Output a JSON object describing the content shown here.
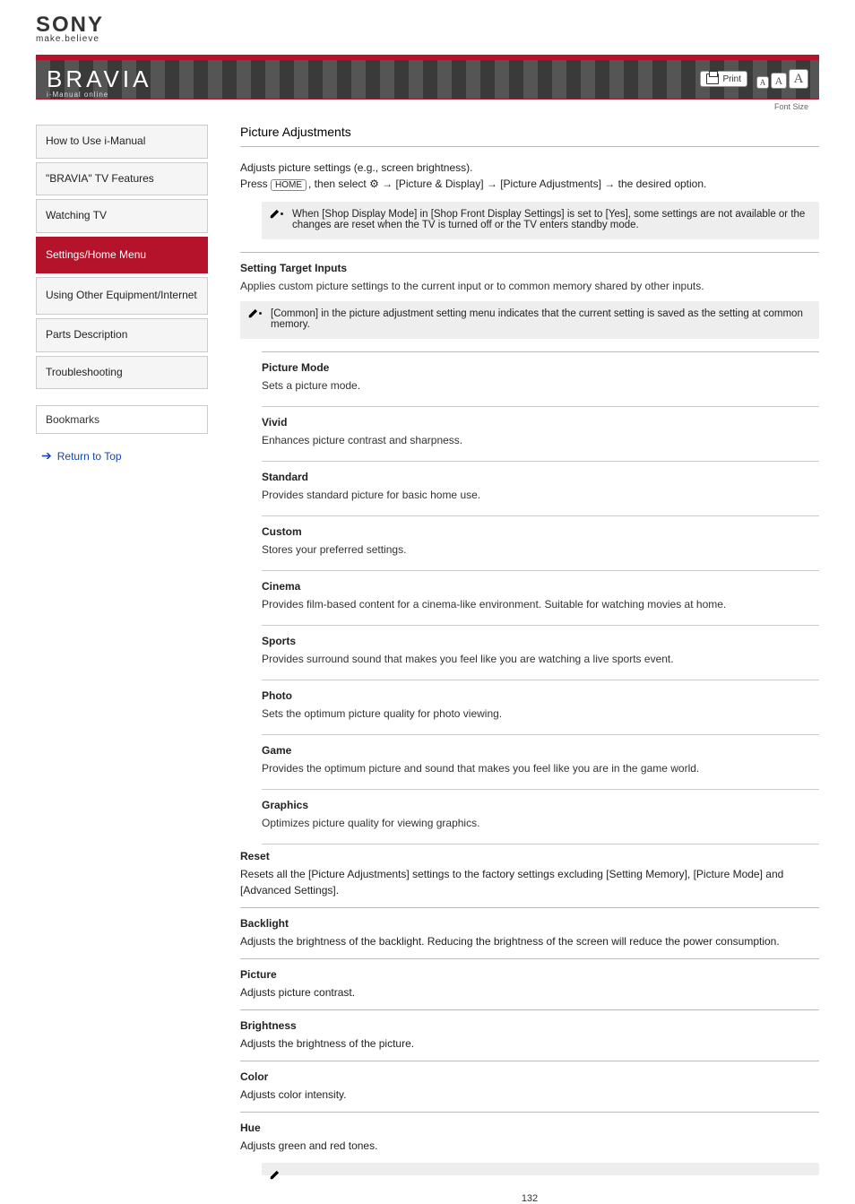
{
  "header": {
    "brand": "SONY",
    "tagline": "make.believe",
    "sub_brand": "BRAVIA",
    "sub_brand_sub": "i-Manual online",
    "print_label": "Print",
    "font_label": "Font Size",
    "font_a": "A"
  },
  "nav": {
    "items": [
      "How to Use i-Manual",
      "\"BRAVIA\" TV Features",
      "Watching TV",
      "Settings/Home Menu",
      "Using Other Equipment/Internet",
      "Parts Description",
      "Troubleshooting"
    ],
    "active_index": 3,
    "bookmarks": "Bookmarks",
    "top_link": "Return to Top"
  },
  "content": {
    "title": "Picture Adjustments",
    "intro": "Adjusts picture settings (e.g., screen brightness).",
    "path_prefix": "Press ",
    "path_home": "HOME",
    "path_mid": ", then select ",
    "path_gear": "⚙",
    "path_arrow": " → ",
    "path_seg1": "[Picture & Display]",
    "path_seg2": "[Picture Adjustments]",
    "path_seg3": "the desired option.",
    "note1_items": [
      "When [Shop Display Mode] in [Shop Front Display Settings] is set to [Yes], some settings are not available or the changes are reset when the TV is turned off or the TV enters standby mode."
    ],
    "setting_target_head": "Setting Target Inputs",
    "setting_target_body": "Applies custom picture settings to the current input or to common memory shared by other inputs.",
    "setting_target_note": [
      "[Common] in the picture adjustment setting menu indicates that the current setting is saved as the setting at common memory."
    ],
    "pic_mode_head": "Picture Mode",
    "pic_mode_body": "Sets a picture mode.",
    "pic_modes": [
      {
        "t": "Vivid",
        "b": "Enhances picture contrast and sharpness."
      },
      {
        "t": "Standard",
        "b": "Provides standard picture for basic home use."
      },
      {
        "t": "Custom",
        "b": "Stores your preferred settings."
      },
      {
        "t": "Cinema",
        "b": "Provides film-based content for a cinema-like environment. Suitable for watching movies at home."
      },
      {
        "t": "Sports",
        "b": "Provides surround sound that makes you feel like you are watching a live sports event."
      },
      {
        "t": "Photo",
        "b": "Sets the optimum picture quality for photo viewing."
      },
      {
        "t": "Game",
        "b": "Provides the optimum picture and sound that makes you feel like you are in the game world."
      },
      {
        "t": "Graphics",
        "b": "Optimizes picture quality for viewing graphics."
      }
    ],
    "rows": [
      {
        "t": "Reset",
        "b": "Resets all the [Picture Adjustments] settings to the factory settings excluding [Setting Memory], [Picture Mode] and [Advanced Settings]."
      },
      {
        "t": "Backlight",
        "b": "Adjusts the brightness of the backlight. Reducing the brightness of the screen will reduce the power consumption."
      },
      {
        "t": "Picture",
        "b": "Adjusts picture contrast."
      },
      {
        "t": "Brightness",
        "b": "Adjusts the brightness of the picture."
      },
      {
        "t": "Color",
        "b": "Adjusts color intensity."
      }
    ],
    "hue": {
      "t": "Hue",
      "b": "Adjusts green and red tones.",
      "note": [
        ""
      ]
    },
    "page_number": "132"
  }
}
